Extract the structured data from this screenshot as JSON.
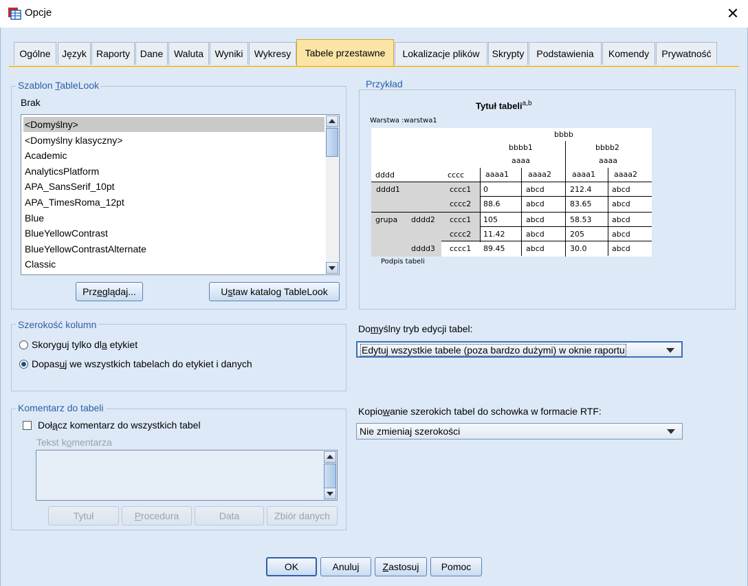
{
  "window": {
    "title": "Opcje",
    "close_glyph": "✕"
  },
  "tabs": [
    {
      "label": "Ogólne"
    },
    {
      "label": "Język"
    },
    {
      "label": "Raporty"
    },
    {
      "label": "Dane"
    },
    {
      "label": "Waluta"
    },
    {
      "label": "Wyniki"
    },
    {
      "label": "Wykresy"
    },
    {
      "label": "Tabele przestawne",
      "active": true
    },
    {
      "label": "Lokalizacje plików"
    },
    {
      "label": "Skrypty"
    },
    {
      "label": "Podstawienia"
    },
    {
      "label": "Komendy"
    },
    {
      "label": "Prywatność"
    }
  ],
  "tablelook": {
    "group_title": "Szablon TableLook",
    "current": "Brak",
    "items": [
      "<Domyślny>",
      "<Domyślny klasyczny>",
      "Academic",
      "AnalyticsPlatform",
      "APA_SansSerif_10pt",
      "APA_TimesRoma_12pt",
      "Blue",
      "BlueYellowContrast",
      "BlueYellowContrastAlternate",
      "Classic"
    ],
    "selected_index": 0,
    "browse_label": "Przeglądaj...",
    "set_dir_label": "Ustaw katalog TableLook"
  },
  "preview": {
    "group_title": "Przykład",
    "title": "Tytuł tabeli",
    "title_sup": "a,b",
    "layer": "Warstwa :warstwa1",
    "caption": "Podpis tabeli",
    "col_header_top": "bbbb",
    "col_groups": [
      "bbbb1",
      "bbbb2"
    ],
    "col_sub": [
      "aaaa",
      "aaaa"
    ],
    "row_dim_labels": [
      "dddd",
      "cccc"
    ],
    "leaf_cols": [
      "aaaa1",
      "aaaa2",
      "aaaa1",
      "aaaa2"
    ],
    "rows": [
      {
        "r1": "dddd1",
        "r2": "",
        "r3": "cccc1",
        "cells": [
          "0",
          "abcd",
          "212.4",
          "abcd"
        ]
      },
      {
        "r1": "",
        "r2": "",
        "r3": "cccc2",
        "cells": [
          "88.6",
          "abcd",
          "83.65",
          "abcd"
        ]
      },
      {
        "r1": "grupa",
        "r2": "dddd2",
        "r3": "cccc1",
        "cells": [
          "105",
          "abcd",
          "58.53",
          "abcd"
        ]
      },
      {
        "r1": "",
        "r2": "",
        "r3": "cccc2",
        "cells": [
          "11.42",
          "abcd",
          "205",
          "abcd"
        ]
      },
      {
        "r1": "",
        "r2": "dddd3",
        "r3": "cccc1",
        "cells": [
          "89.45",
          "abcd",
          "30.0",
          "abcd"
        ]
      }
    ]
  },
  "column_width": {
    "group_title": "Szerokość kolumn",
    "options": [
      {
        "label": "Skoryguj tylko dla etykiet",
        "selected": false
      },
      {
        "label": "Dopasuj we wszystkich tabelach do etykiet i danych",
        "selected": true
      }
    ]
  },
  "edit_mode": {
    "label": "Domyślny tryb edycji tabel:",
    "value": "Edytuj wszystkie tabele (poza bardzo dużymi) w oknie raportu"
  },
  "rtf_copy": {
    "label": "Kopiowanie szerokich tabel do schowka w formacie RTF:",
    "value": "Nie zmieniaj szerokości"
  },
  "comment": {
    "group_title": "Komentarz do tabeli",
    "checkbox_label": "Dołącz komentarz do wszystkich tabel",
    "checked": false,
    "text_label": "Tekst komentarza",
    "text_value": "",
    "buttons": [
      "Tytuł",
      "Procedura",
      "Data",
      "Zbiór danych"
    ]
  },
  "footer": {
    "ok": "OK",
    "cancel": "Anuluj",
    "apply": "Zastosuj",
    "help": "Pomoc"
  }
}
